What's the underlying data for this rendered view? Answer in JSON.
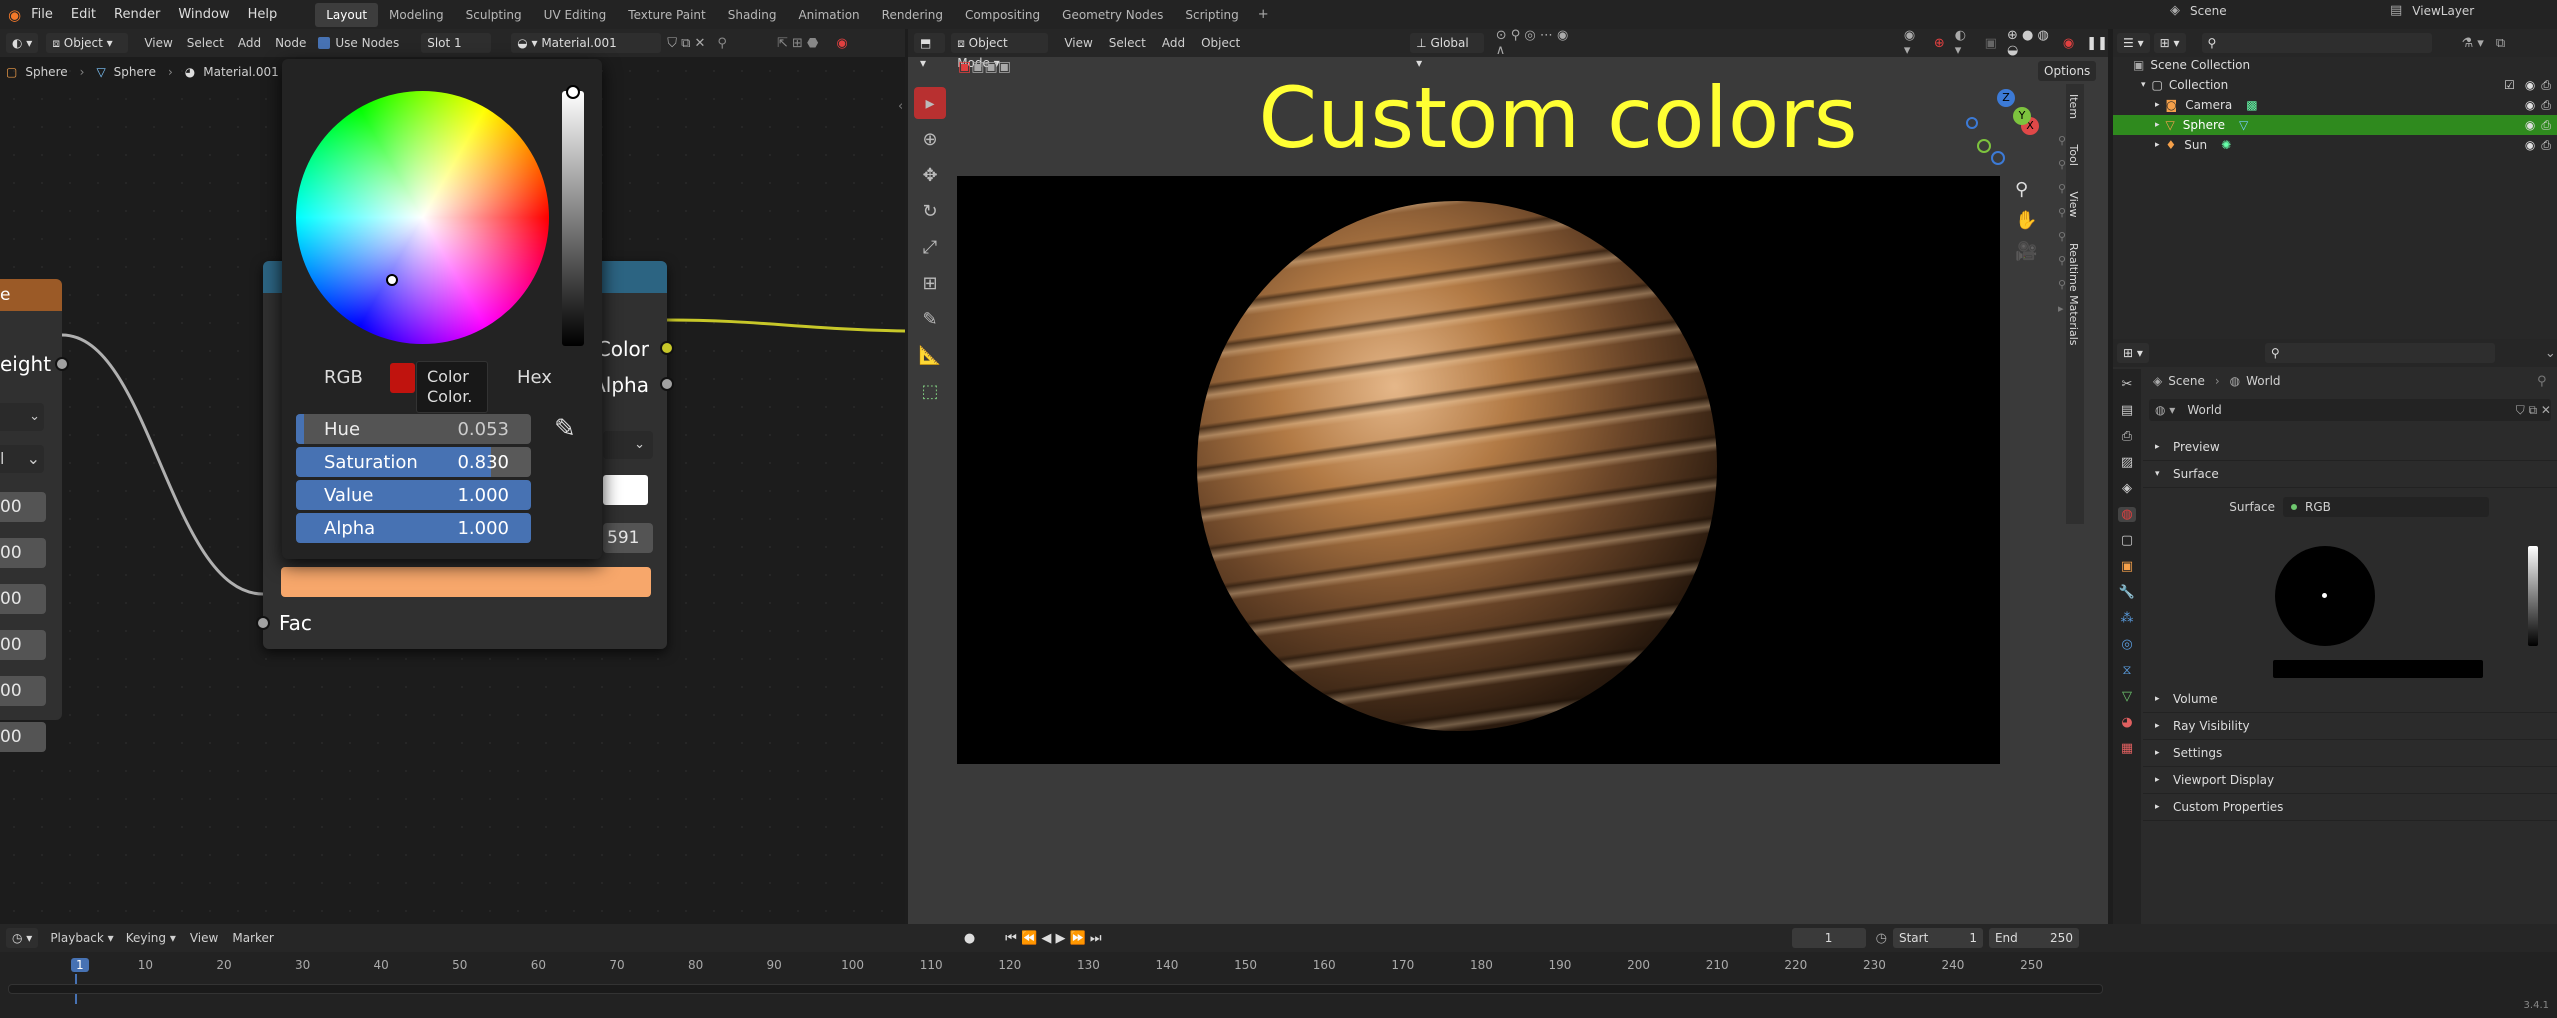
{
  "menu": [
    "File",
    "Edit",
    "Render",
    "Window",
    "Help"
  ],
  "workspaces": [
    "Layout",
    "Modeling",
    "Sculpting",
    "UV Editing",
    "Texture Paint",
    "Shading",
    "Animation",
    "Rendering",
    "Compositing",
    "Geometry Nodes",
    "Scripting"
  ],
  "active_workspace": "Layout",
  "scene_label": "Scene",
  "viewlayer_label": "ViewLayer",
  "node_header": {
    "object_mode": "Object",
    "view": "View",
    "select": "Select",
    "add": "Add",
    "node": "Node",
    "use_nodes": "Use Nodes",
    "slot": "Slot 1",
    "material": "Material.001"
  },
  "breadcrumb": [
    "Sphere",
    "Sphere",
    "Material.001"
  ],
  "left_node": {
    "header_char": "e",
    "output_label": "eight",
    "field_values": [
      "00",
      "00",
      "00",
      "00",
      "00",
      "00"
    ],
    "dropdown_a": "",
    "dropdown_b": "l"
  },
  "rgb_node": {
    "output_color": "Color",
    "output_alpha": "Alpha",
    "input_fac": "Fac",
    "hex_field_suffix": "591"
  },
  "color_picker": {
    "modes": [
      "RGB",
      "Hex"
    ],
    "tooltip_title": "Color",
    "tooltip_sub": "Color.",
    "hue_label": "Hue",
    "hue_value": "0.053",
    "sat_label": "Saturation",
    "sat_value": "0.830",
    "val_label": "Value",
    "val_value": "1.000",
    "alpha_label": "Alpha",
    "alpha_value": "1.000",
    "result_color": "#f7a76b"
  },
  "viewport": {
    "mode": "Object Mode",
    "view": "View",
    "select": "Select",
    "add": "Add",
    "object": "Object",
    "orientation": "Global",
    "options": "Options",
    "overlay_title": "Custom colors",
    "side_tabs": [
      "Item",
      "Tool",
      "View",
      "Realtime Materials"
    ]
  },
  "outliner": {
    "root": "Scene Collection",
    "collection": "Collection",
    "items": [
      {
        "name": "Camera",
        "selected": false
      },
      {
        "name": "Sphere",
        "selected": true
      },
      {
        "name": "Sun",
        "selected": false
      }
    ]
  },
  "properties": {
    "breadcrumb": [
      "Scene",
      "World"
    ],
    "world_name": "World",
    "panels_top": [
      "Preview",
      "Surface"
    ],
    "surface_label": "Surface",
    "surface_value": "RGB",
    "panels_bottom": [
      "Volume",
      "Ray Visibility",
      "Settings",
      "Viewport Display",
      "Custom Properties"
    ]
  },
  "timeline": {
    "playback": "Playback",
    "keying": "Keying",
    "view": "View",
    "marker": "Marker",
    "current_frame": "1",
    "start_label": "Start",
    "start_value": "1",
    "end_label": "End",
    "end_value": "250",
    "ticks": [
      "1",
      "10",
      "20",
      "30",
      "40",
      "50",
      "60",
      "70",
      "80",
      "90",
      "100",
      "110",
      "120",
      "130",
      "140",
      "150",
      "160",
      "170",
      "180",
      "190",
      "200",
      "210",
      "220",
      "230",
      "240",
      "250"
    ],
    "version": "3.4.1"
  }
}
